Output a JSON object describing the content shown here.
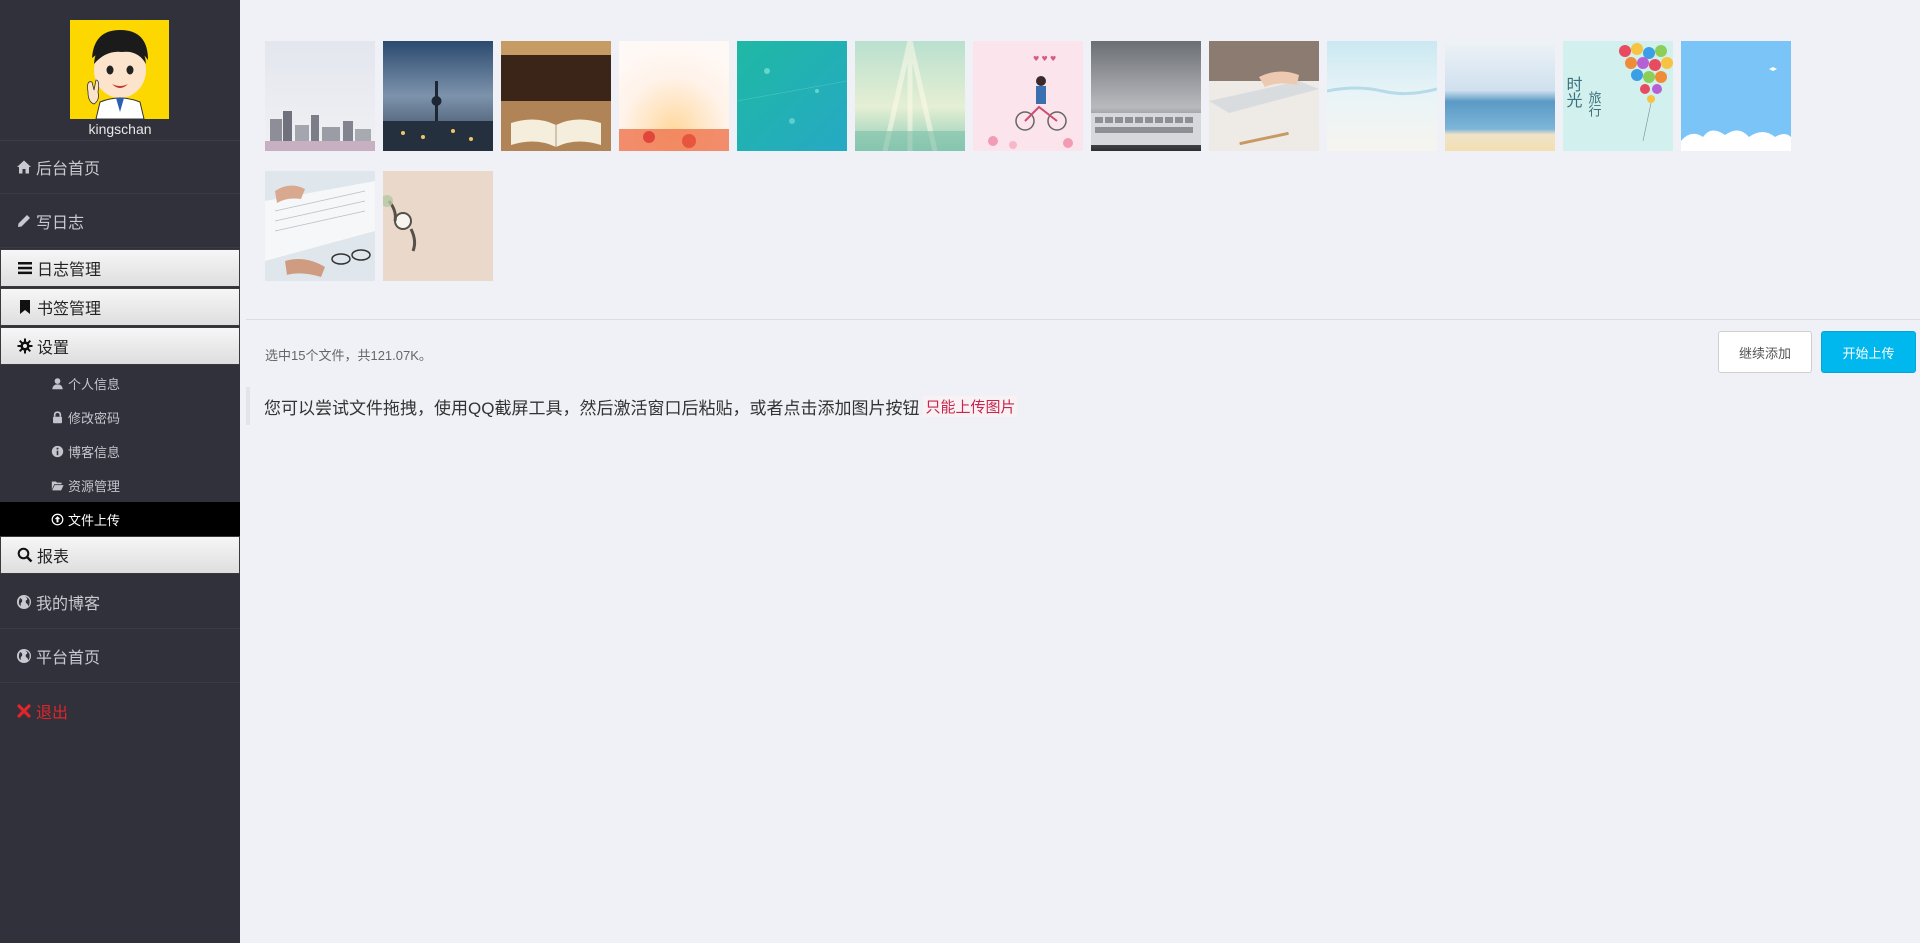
{
  "sidebar": {
    "username": "kingschan",
    "nav": {
      "home": "后台首页",
      "write": "写日志",
      "log_manage": "日志管理",
      "bookmark_manage": "书签管理",
      "settings": "设置",
      "report": "报表",
      "my_blog": "我的博客",
      "platform_home": "平台首页",
      "logout": "退出"
    },
    "settings_items": {
      "personal_info": "个人信息",
      "change_password": "修改密码",
      "blog_info": "博客信息",
      "resource_manage": "资源管理",
      "file_upload": "文件上传"
    }
  },
  "uploader": {
    "status": "选中15个文件，共121.07K。",
    "continue_add": "继续添加",
    "start_upload": "开始上传",
    "hint": "您可以尝试文件拖拽，使用QQ截屏工具，然后激活窗口后粘贴，或者点击添加图片按钮",
    "hint_warning": "只能上传图片"
  },
  "colors": {
    "sidebar_bg": "#30313a",
    "main_bg": "#f0f1f6",
    "upload_button": "#00b7ee",
    "logout": "#e0262a",
    "warning": "#c7254e"
  },
  "thumbnails": [
    {
      "name": "city-skyline-fog"
    },
    {
      "name": "city-tower-dusk"
    },
    {
      "name": "library-book"
    },
    {
      "name": "bright-sunset-glow"
    },
    {
      "name": "teal-bokeh"
    },
    {
      "name": "green-light-rays"
    },
    {
      "name": "pink-couple-bicycle"
    },
    {
      "name": "keyboard-grey"
    },
    {
      "name": "laptop-typing"
    },
    {
      "name": "pale-beach"
    },
    {
      "name": "sea-horizon"
    },
    {
      "name": "travel-balloons"
    },
    {
      "name": "blue-sky-cloud"
    },
    {
      "name": "hands-keyboard-glasses"
    },
    {
      "name": "beige-watch"
    }
  ]
}
